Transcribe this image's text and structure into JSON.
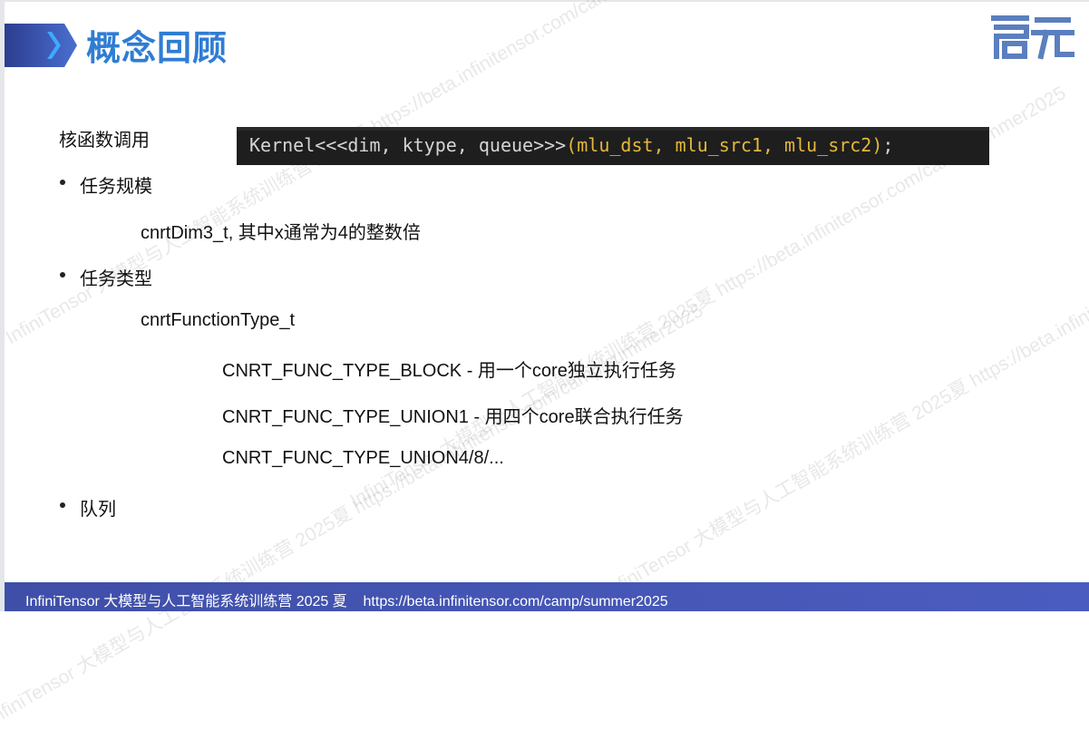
{
  "header": {
    "title": "概念回顾",
    "logo_text": "启元"
  },
  "code": {
    "line": "Kernel<<<dim, ktype, queue>>>",
    "args": "(mlu_dst, mlu_src1, mlu_src2)",
    "end": ";"
  },
  "content": {
    "section_label": "核函数调用",
    "items": [
      {
        "label": "任务规模"
      },
      {
        "label": "任务类型"
      },
      {
        "label": "队列"
      }
    ],
    "dim_desc": "cnrtDim3_t, 其中x通常为4的整数倍",
    "func_type": "cnrtFunctionType_t",
    "types": [
      "CNRT_FUNC_TYPE_BLOCK - 用一个core独立执行任务",
      "CNRT_FUNC_TYPE_UNION1 - 用四个core联合执行任务",
      "CNRT_FUNC_TYPE_UNION4/8/..."
    ]
  },
  "watermark": {
    "text": "InfiniTensor 大模型与人工智能系统训练营 2025夏 https://beta.infinitensor.com/camp/summer2025"
  },
  "footer": {
    "text": "InfiniTensor 大模型与人工智能系统训练营 2025 夏    https://beta.infinitensor.com/camp/summer2025"
  },
  "colors": {
    "title": "#2f7dd3",
    "banner": "#4a6fd0",
    "logo": "#5b7fbe",
    "footer": "#4352b0"
  }
}
